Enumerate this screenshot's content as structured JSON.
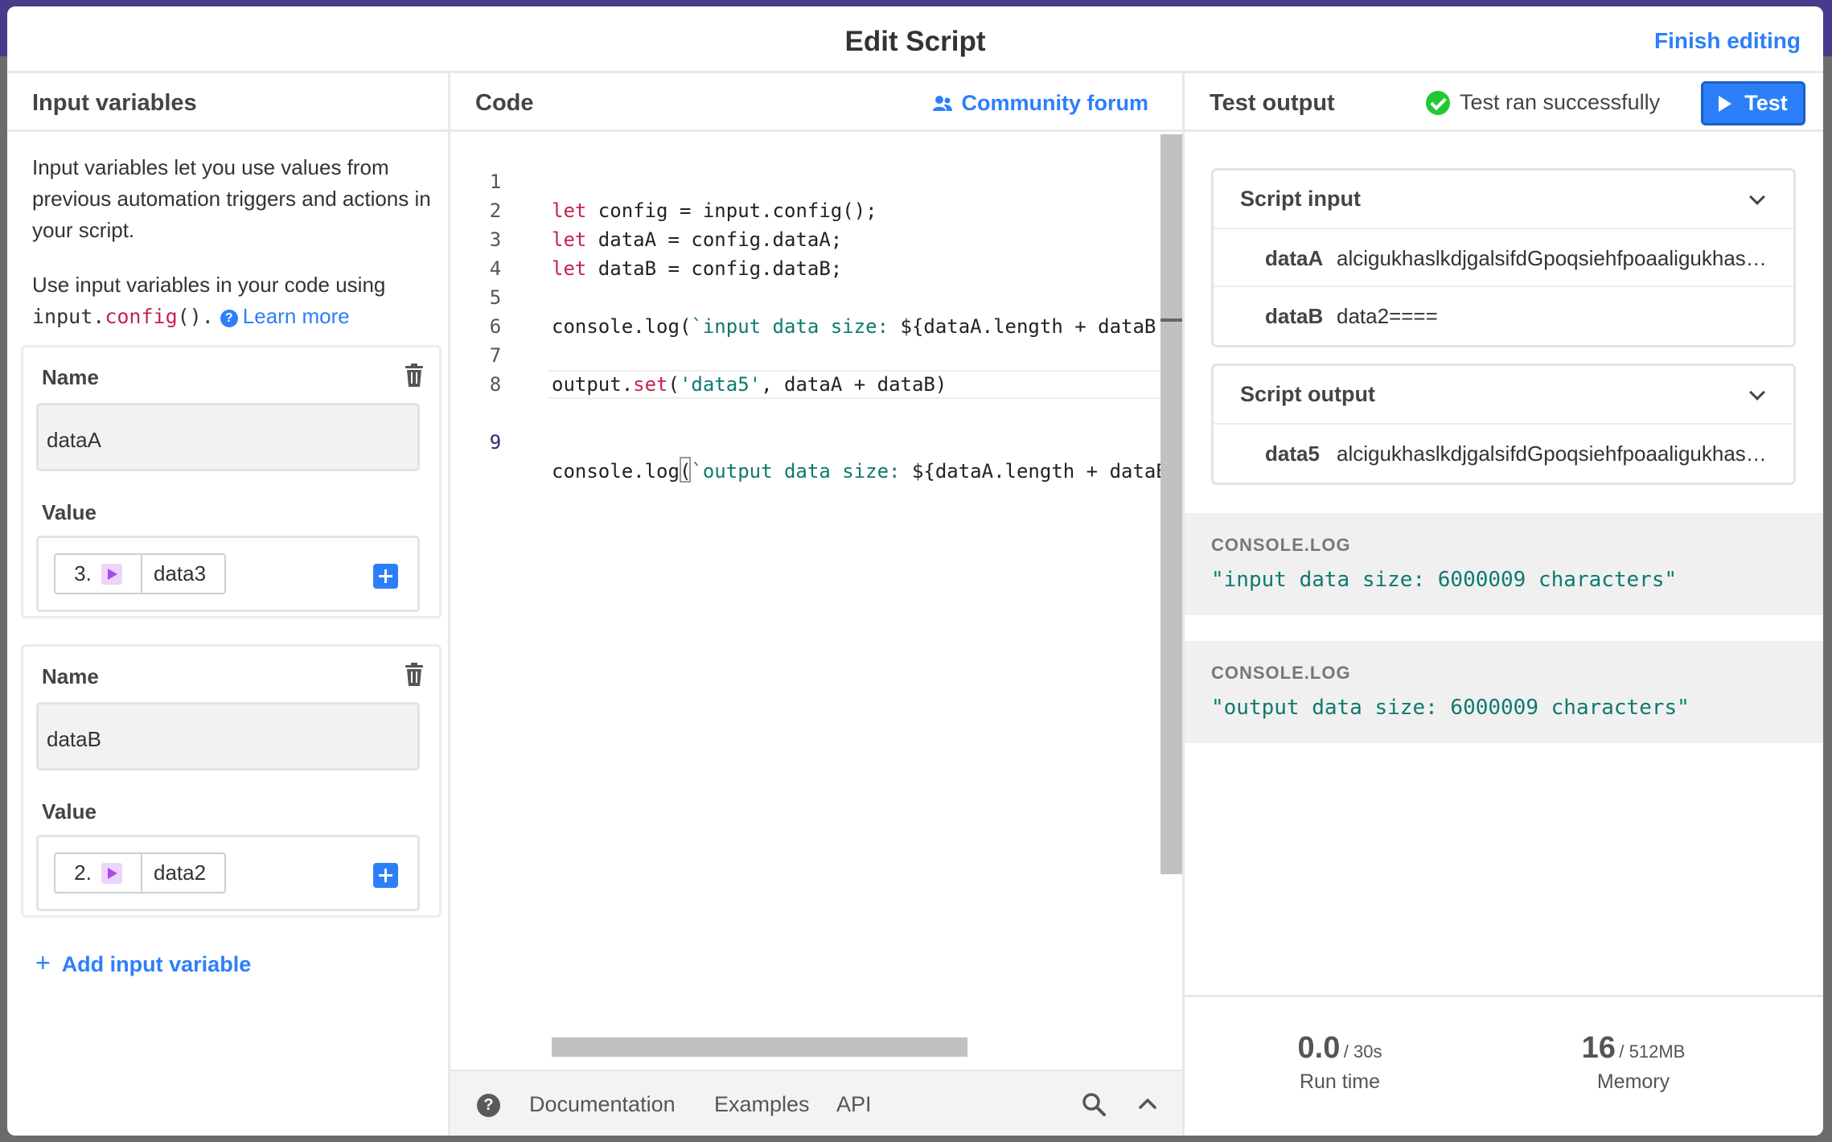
{
  "modal": {
    "title": "Edit Script",
    "finish_label": "Finish editing"
  },
  "left": {
    "heading": "Input variables",
    "description": "Input variables let you use values from previous automation triggers and actions in your script.",
    "usage_prefix": "Use input variables in your code using",
    "usage_code_obj": "input",
    "usage_code_dot": ".",
    "usage_code_fn": "config",
    "usage_code_end": "().",
    "learn_more": "Learn more",
    "variables": [
      {
        "name_label": "Name",
        "name": "dataA",
        "value_label": "Value",
        "step": "3.",
        "token": "data3"
      },
      {
        "name_label": "Name",
        "name": "dataB",
        "value_label": "Value",
        "step": "2.",
        "token": "data2"
      }
    ],
    "add_label": "Add input variable",
    "add_plus": "+"
  },
  "middle": {
    "heading": "Code",
    "community": "Community forum",
    "line_numbers": [
      "1",
      "2",
      "3",
      "4",
      "5",
      "6",
      "7",
      "8",
      "9"
    ],
    "code": {
      "l1_kw": "let",
      "l1_rest": " config = input.config();",
      "l2_kw": "let",
      "l2_rest": " dataA = config.dataA;",
      "l3_kw": "let",
      "l3_rest": " dataB = config.dataB;",
      "l5_a": "console.log(",
      "l5_str": "`input data size: ",
      "l5_b": "${dataA.length + dataB.length} characters`);",
      "l7_a": "output.",
      "l7_kw": "set",
      "l7_b": "(",
      "l7_str": "'data5'",
      "l7_c": ", dataA + dataB)",
      "l9_a": "console.log(",
      "l9_str": "`output data size: ",
      "l9_b": "${dataA.length + dataB.length} characters`);"
    },
    "footer": {
      "help": "?",
      "documentation": "Documentation",
      "examples": "Examples",
      "api": "API"
    }
  },
  "right": {
    "heading": "Test output",
    "status": "Test ran successfully",
    "test_label": "Test",
    "script_input": {
      "title": "Script input",
      "rows": [
        {
          "key": "dataA",
          "value": "alcigukhaslkdjgalsifdGpoqsiehfpoaaligukhaslkdjgalsifdGpoqsiehfpoaaligukh"
        },
        {
          "key": "dataB",
          "value": "data2===="
        }
      ]
    },
    "script_output": {
      "title": "Script output",
      "rows": [
        {
          "key": "data5",
          "value": "alcigukhaslkdjgalsifdGpoqsiehfpoaaligukhaslkdjgalsifdGpoqsiehfpoaaligukh"
        }
      ]
    },
    "logs": [
      {
        "label": "CONSOLE.LOG",
        "text": "\"input data size: 6000009 characters\""
      },
      {
        "label": "CONSOLE.LOG",
        "text": "\"output data size: 6000009 characters\""
      }
    ],
    "stats": {
      "runtime_value": "0.0",
      "runtime_max": "/ 30s",
      "runtime_label": "Run time",
      "memory_value": "16",
      "memory_max": "/ 512MB",
      "memory_label": "Memory"
    }
  },
  "colors": {
    "accent": "#2d7ff9",
    "success": "#20c933",
    "keyword": "#c6244c",
    "string": "#0e7a6d"
  }
}
